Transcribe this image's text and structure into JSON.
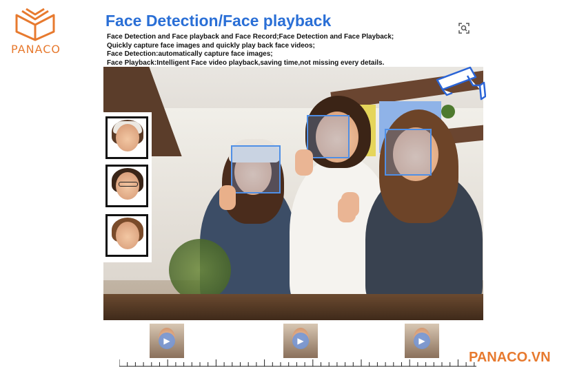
{
  "brand": {
    "name": "PANACO",
    "color": "#e77a2f",
    "icon": "open-book-logo"
  },
  "title": "Face Detection/Face playback",
  "description": [
    "Face Detection and Face playback and Face Record;Face Detection and Face Playback;",
    "Quickly capture face images and quickly play back face videos;",
    "Face Detection:automatically capture face images;",
    "Face Playback:Intelligent Face video playback,saving time,not missing every details."
  ],
  "thumbnails": [
    {
      "name": "face-snapshot-1"
    },
    {
      "name": "face-snapshot-2"
    },
    {
      "name": "face-snapshot-3"
    }
  ],
  "video_clips": [
    {
      "name": "playback-clip-1",
      "icon": "play-icon"
    },
    {
      "name": "playback-clip-2",
      "icon": "play-icon"
    },
    {
      "name": "playback-clip-3",
      "icon": "play-icon"
    }
  ],
  "website": "PANACO.VN",
  "accent": "#2a6fd6"
}
